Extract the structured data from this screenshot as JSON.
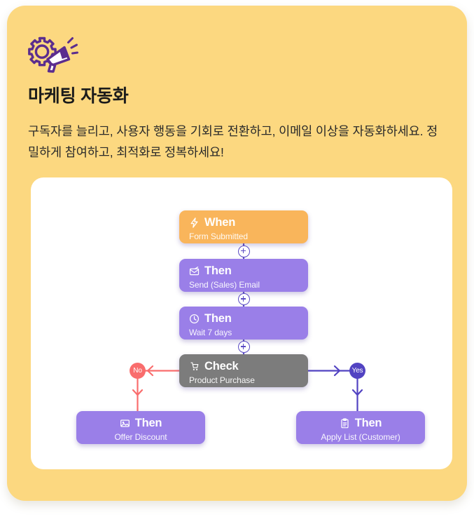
{
  "header": {
    "icon": "megaphone-gear-icon",
    "title": "마케팅 자동화",
    "description": "구독자를 늘리고, 사용자 행동을 기회로 전환하고, 이메일 이상을 자동화하세요. 정밀하게 참여하고, 최적화로 정복하세요!"
  },
  "colors": {
    "card_background": "#FCD880",
    "canvas_background": "#FFFFFF",
    "trigger_node": "#F9B55B",
    "action_node": "#9A7FE8",
    "condition_node": "#7C7C7C",
    "yes_branch": "#5243C2",
    "no_branch": "#F96D6D",
    "connector": "#5B4BC4",
    "icon_purple": "#5B2D8E"
  },
  "flow": {
    "nodes": [
      {
        "id": "when",
        "kind": "trigger",
        "icon": "lightning-bolt-icon",
        "title": "When",
        "subtitle": "Form Submitted"
      },
      {
        "id": "send-email",
        "kind": "action",
        "icon": "envelope-icon",
        "title": "Then",
        "subtitle": "Send (Sales) Email"
      },
      {
        "id": "wait",
        "kind": "action",
        "icon": "clock-icon",
        "title": "Then",
        "subtitle": "Wait 7 days"
      },
      {
        "id": "check",
        "kind": "condition",
        "icon": "cart-icon",
        "title": "Check",
        "subtitle": "Product Purchase"
      },
      {
        "id": "offer-discount",
        "kind": "action",
        "icon": "discount-image-icon",
        "title": "Then",
        "subtitle": "Offer Discount"
      },
      {
        "id": "apply-list",
        "kind": "action",
        "icon": "clipboard-icon",
        "title": "Then",
        "subtitle": "Apply List (Customer)"
      }
    ],
    "connectors": [
      {
        "id": "plus-1",
        "label": "+"
      },
      {
        "id": "plus-2",
        "label": "+"
      },
      {
        "id": "plus-3",
        "label": "+"
      }
    ],
    "branches": [
      {
        "id": "no",
        "label": "No",
        "target": "offer-discount"
      },
      {
        "id": "yes",
        "label": "Yes",
        "target": "apply-list"
      }
    ]
  }
}
